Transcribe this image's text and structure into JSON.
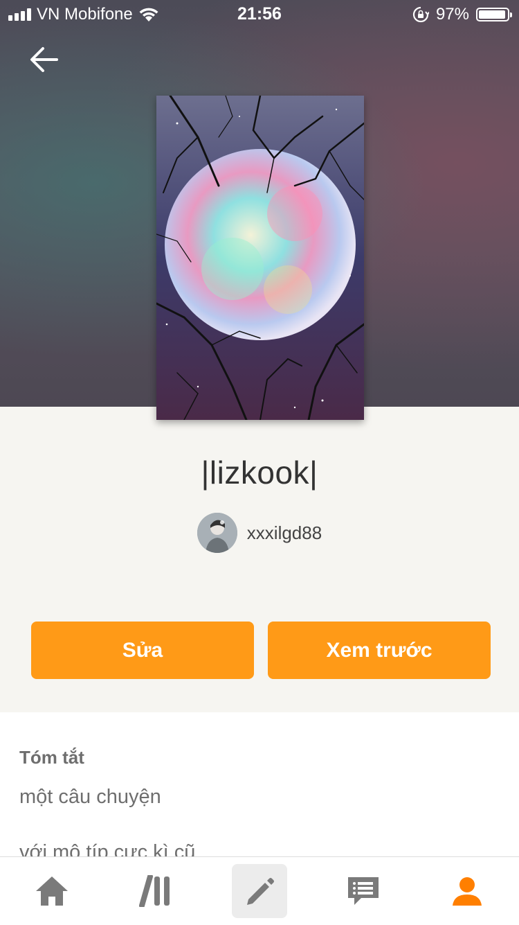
{
  "status_bar": {
    "carrier": "VN Mobifone",
    "time": "21:56",
    "battery": "97%"
  },
  "story": {
    "title": "|lizkook|",
    "author": "xxxilgd88"
  },
  "actions": {
    "edit_label": "Sửa",
    "preview_label": "Xem trước"
  },
  "summary": {
    "heading": "Tóm tắt",
    "line1": "một câu chuyện",
    "line2": "với mô típ cực kì cũ"
  },
  "tabbar": {
    "items": [
      {
        "icon": "home-icon"
      },
      {
        "icon": "library-icon"
      },
      {
        "icon": "write-icon",
        "active": true
      },
      {
        "icon": "messages-icon"
      },
      {
        "icon": "profile-icon"
      }
    ],
    "accent_color": "#ff7f00"
  },
  "colors": {
    "button": "#ff9a17",
    "icon_gray": "#7a7a7a"
  }
}
